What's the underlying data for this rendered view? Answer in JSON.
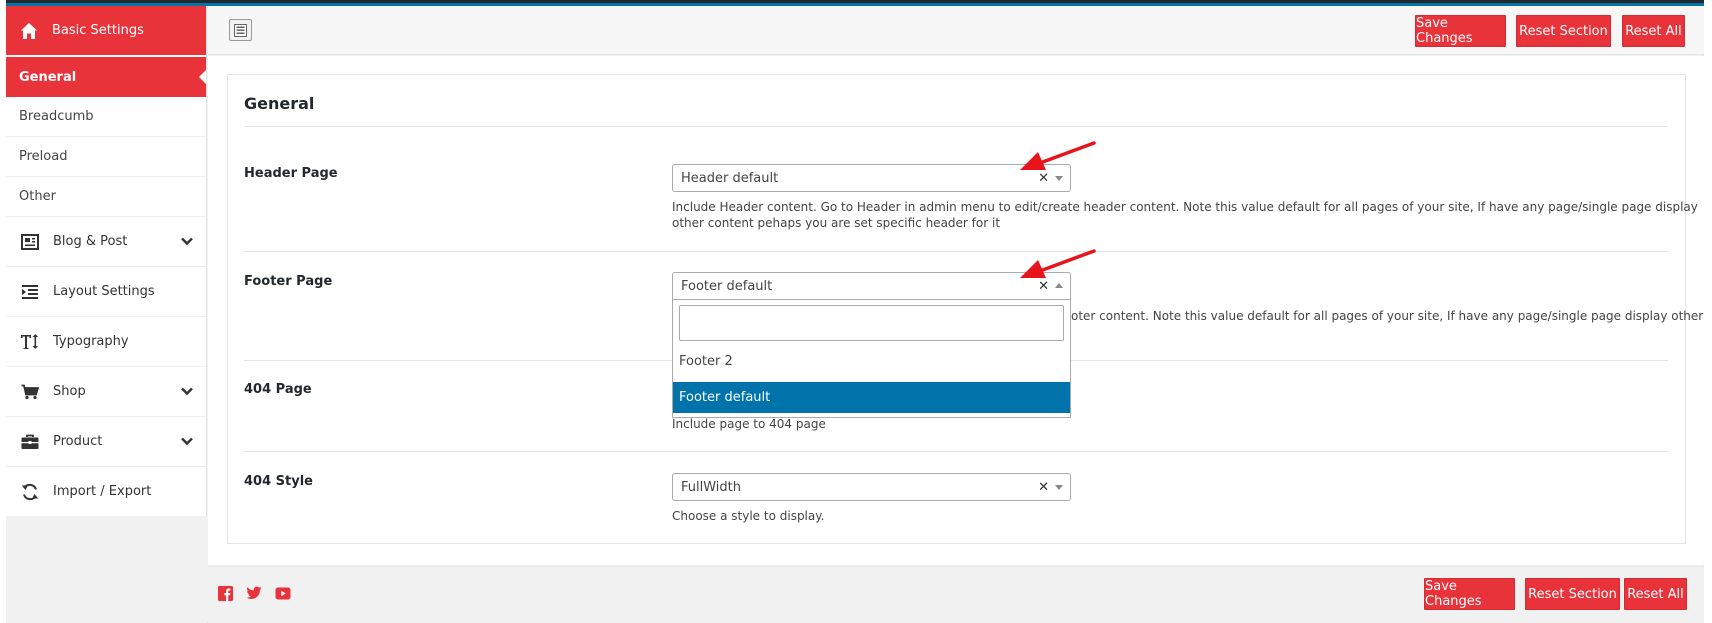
{
  "sidebar": {
    "header_label": "Basic Settings",
    "active_item": "General",
    "sub_items": [
      "Breadcumb",
      "Preload",
      "Other"
    ],
    "items": [
      {
        "label": "Blog & Post",
        "icon": "blog-icon",
        "expandable": true
      },
      {
        "label": "Layout Settings",
        "icon": "layout-icon",
        "expandable": false
      },
      {
        "label": "Typography",
        "icon": "typography-icon",
        "expandable": false
      },
      {
        "label": "Shop",
        "icon": "cart-icon",
        "expandable": true
      },
      {
        "label": "Product",
        "icon": "briefcase-icon",
        "expandable": true
      },
      {
        "label": "Import / Export",
        "icon": "refresh-icon",
        "expandable": false
      }
    ]
  },
  "toolbar": {
    "save_label": "Save Changes",
    "reset_section_label": "Reset Section",
    "reset_all_label": "Reset All"
  },
  "section": {
    "title": "General",
    "fields": [
      {
        "label": "Header Page",
        "value": "Header default",
        "description_line1": "Include Header content. Go to Header in admin menu to edit/create header content. Note this value default for all pages of your site, If have any page/single page display",
        "description_line2": "other content pehaps you are set specific header for it"
      },
      {
        "label": "Footer Page",
        "value": "Footer default",
        "description_visible": "oter content. Note this value default for all pages of your site, If have any page/single page display other",
        "dropdown_open": true,
        "dropdown_search_value": "",
        "dropdown_options": [
          {
            "label": "Footer 2",
            "selected": false
          },
          {
            "label": "Footer default",
            "selected": true
          }
        ]
      },
      {
        "label": "404 Page",
        "description": "Include page to 404 page"
      },
      {
        "label": "404 Style",
        "value": "FullWidth",
        "description": "Choose a style to display."
      }
    ]
  },
  "footer": {
    "social_icons": [
      "facebook-icon",
      "twitter-icon",
      "youtube-icon"
    ]
  },
  "colors": {
    "accent": "#e8333b",
    "selected_option": "#0073aa",
    "annotation_arrow": "#e8141b"
  }
}
